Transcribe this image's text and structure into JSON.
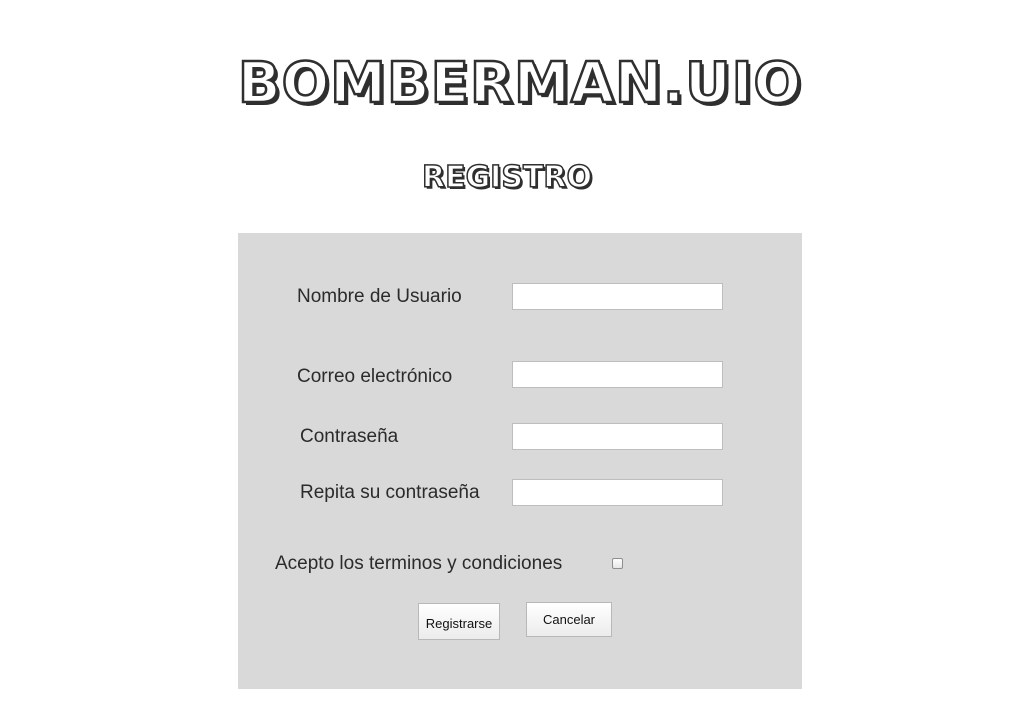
{
  "header": {
    "title": "BOMBERMAN.UIO",
    "subtitle": "REGISTRO"
  },
  "form": {
    "username": {
      "label": "Nombre de Usuario",
      "value": ""
    },
    "email": {
      "label": "Correo electrónico",
      "value": ""
    },
    "password": {
      "label": "Contraseña",
      "value": ""
    },
    "password_repeat": {
      "label": "Repita su contraseña",
      "value": ""
    },
    "terms": {
      "label": "Acepto los terminos y condiciones",
      "checked": false
    },
    "submit_label": "Registrarse",
    "cancel_label": "Cancelar"
  },
  "colors": {
    "panel_background": "#d9d9d9",
    "text": "#2b2b2b",
    "logo_outline": "#2f2f2f"
  }
}
